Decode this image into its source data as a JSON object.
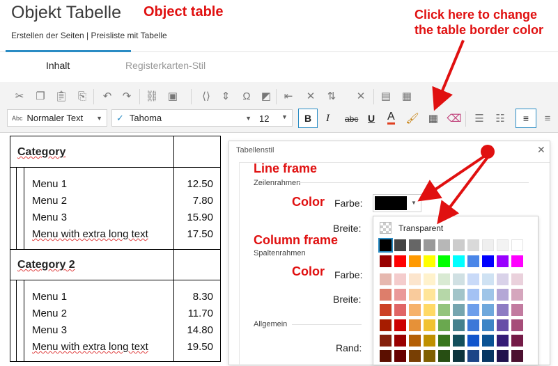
{
  "header": {
    "title": "Objekt Tabelle",
    "title_annotation": "Object table",
    "subtitle": "Erstellen der Seiten | Preisliste mit Tabelle"
  },
  "callout": {
    "line1": "Click here to change",
    "line2": "the table border color"
  },
  "tabs": [
    {
      "label": "Inhalt",
      "active": true
    },
    {
      "label": "Registerkarten-Stil",
      "active": false
    }
  ],
  "toolbar": {
    "style_prefix": "Abc",
    "style_value": "Normaler Text",
    "font_check": "✓",
    "font_value": "Tahoma",
    "size_value": "12",
    "bold": "B",
    "italic": "I",
    "strike": "abc",
    "underline": "U",
    "font_color": "A"
  },
  "document": {
    "categories": [
      {
        "name": "Category",
        "items": [
          {
            "name": "Menu 1",
            "price": "12.50"
          },
          {
            "name": "Menu 2",
            "price": "7.80"
          },
          {
            "name": "Menu 3",
            "price": "15.90"
          },
          {
            "name": "Menu with extra long text",
            "price": "17.50"
          }
        ]
      },
      {
        "name": "Category 2",
        "items": [
          {
            "name": "Menu 1",
            "price": "8.30"
          },
          {
            "name": "Menu 2",
            "price": "11.70"
          },
          {
            "name": "Menu 3",
            "price": "14.80"
          },
          {
            "name": "Menu with extra long text",
            "price": "19.50"
          }
        ]
      }
    ]
  },
  "dialog": {
    "title": "Tabellenstil",
    "close": "✕",
    "line_frame_annotation": "Line frame",
    "row_frame_header": "Zeilenrahmen",
    "color_annotation": "Color",
    "farbe_label": "Farbe:",
    "breite_label": "Breite:",
    "column_frame_annotation": "Column frame",
    "column_frame_header": "Spaltenrahmen",
    "color_annotation_2": "Color",
    "farbe_label_2": "Farbe:",
    "breite_label_2": "Breite:",
    "general_header": "Allgemein",
    "rand_label": "Rand:",
    "selected_color": "#000000"
  },
  "palette": {
    "transparent_label": "Transparent",
    "rows": [
      [
        "#000000",
        "#444444",
        "#666666",
        "#999999",
        "#b7b7b7",
        "#cccccc",
        "#d9d9d9",
        "#efefef",
        "#f3f3f3",
        "#ffffff"
      ],
      [
        "#980000",
        "#ff0000",
        "#ff9900",
        "#ffff00",
        "#00ff00",
        "#00ffff",
        "#4a86e8",
        "#0000ff",
        "#9900ff",
        "#ff00ff"
      ],
      [
        "#e6b8af",
        "#f4cccc",
        "#fce5cd",
        "#fff2cc",
        "#d9ead3",
        "#d0e0e3",
        "#c9daf8",
        "#cfe2f3",
        "#d9d2e9",
        "#ead1dc"
      ],
      [
        "#dd7e6b",
        "#ea9999",
        "#f9cb9c",
        "#ffe599",
        "#b6d7a8",
        "#a2c4c9",
        "#a4c2f4",
        "#9fc5e8",
        "#b4a7d6",
        "#d5a6bd"
      ],
      [
        "#cc4125",
        "#e06666",
        "#f6b26b",
        "#ffd966",
        "#93c47d",
        "#76a5af",
        "#6d9eeb",
        "#6fa8dc",
        "#8e7cc3",
        "#c27ba0"
      ],
      [
        "#a61c00",
        "#cc0000",
        "#e69138",
        "#f1c232",
        "#6aa84f",
        "#45818e",
        "#3c78d8",
        "#3d85c6",
        "#674ea7",
        "#a64d79"
      ],
      [
        "#85200c",
        "#990000",
        "#b45f06",
        "#bf9000",
        "#38761d",
        "#134f5c",
        "#1155cc",
        "#0b5394",
        "#351c75",
        "#741b47"
      ],
      [
        "#5b0f00",
        "#660000",
        "#783f04",
        "#7f6000",
        "#274e13",
        "#0c343d",
        "#1c4587",
        "#073763",
        "#20124d",
        "#4c1130"
      ]
    ]
  },
  "colors": {
    "accent": "#2a8cc4",
    "annotation_red": "#e01010"
  }
}
